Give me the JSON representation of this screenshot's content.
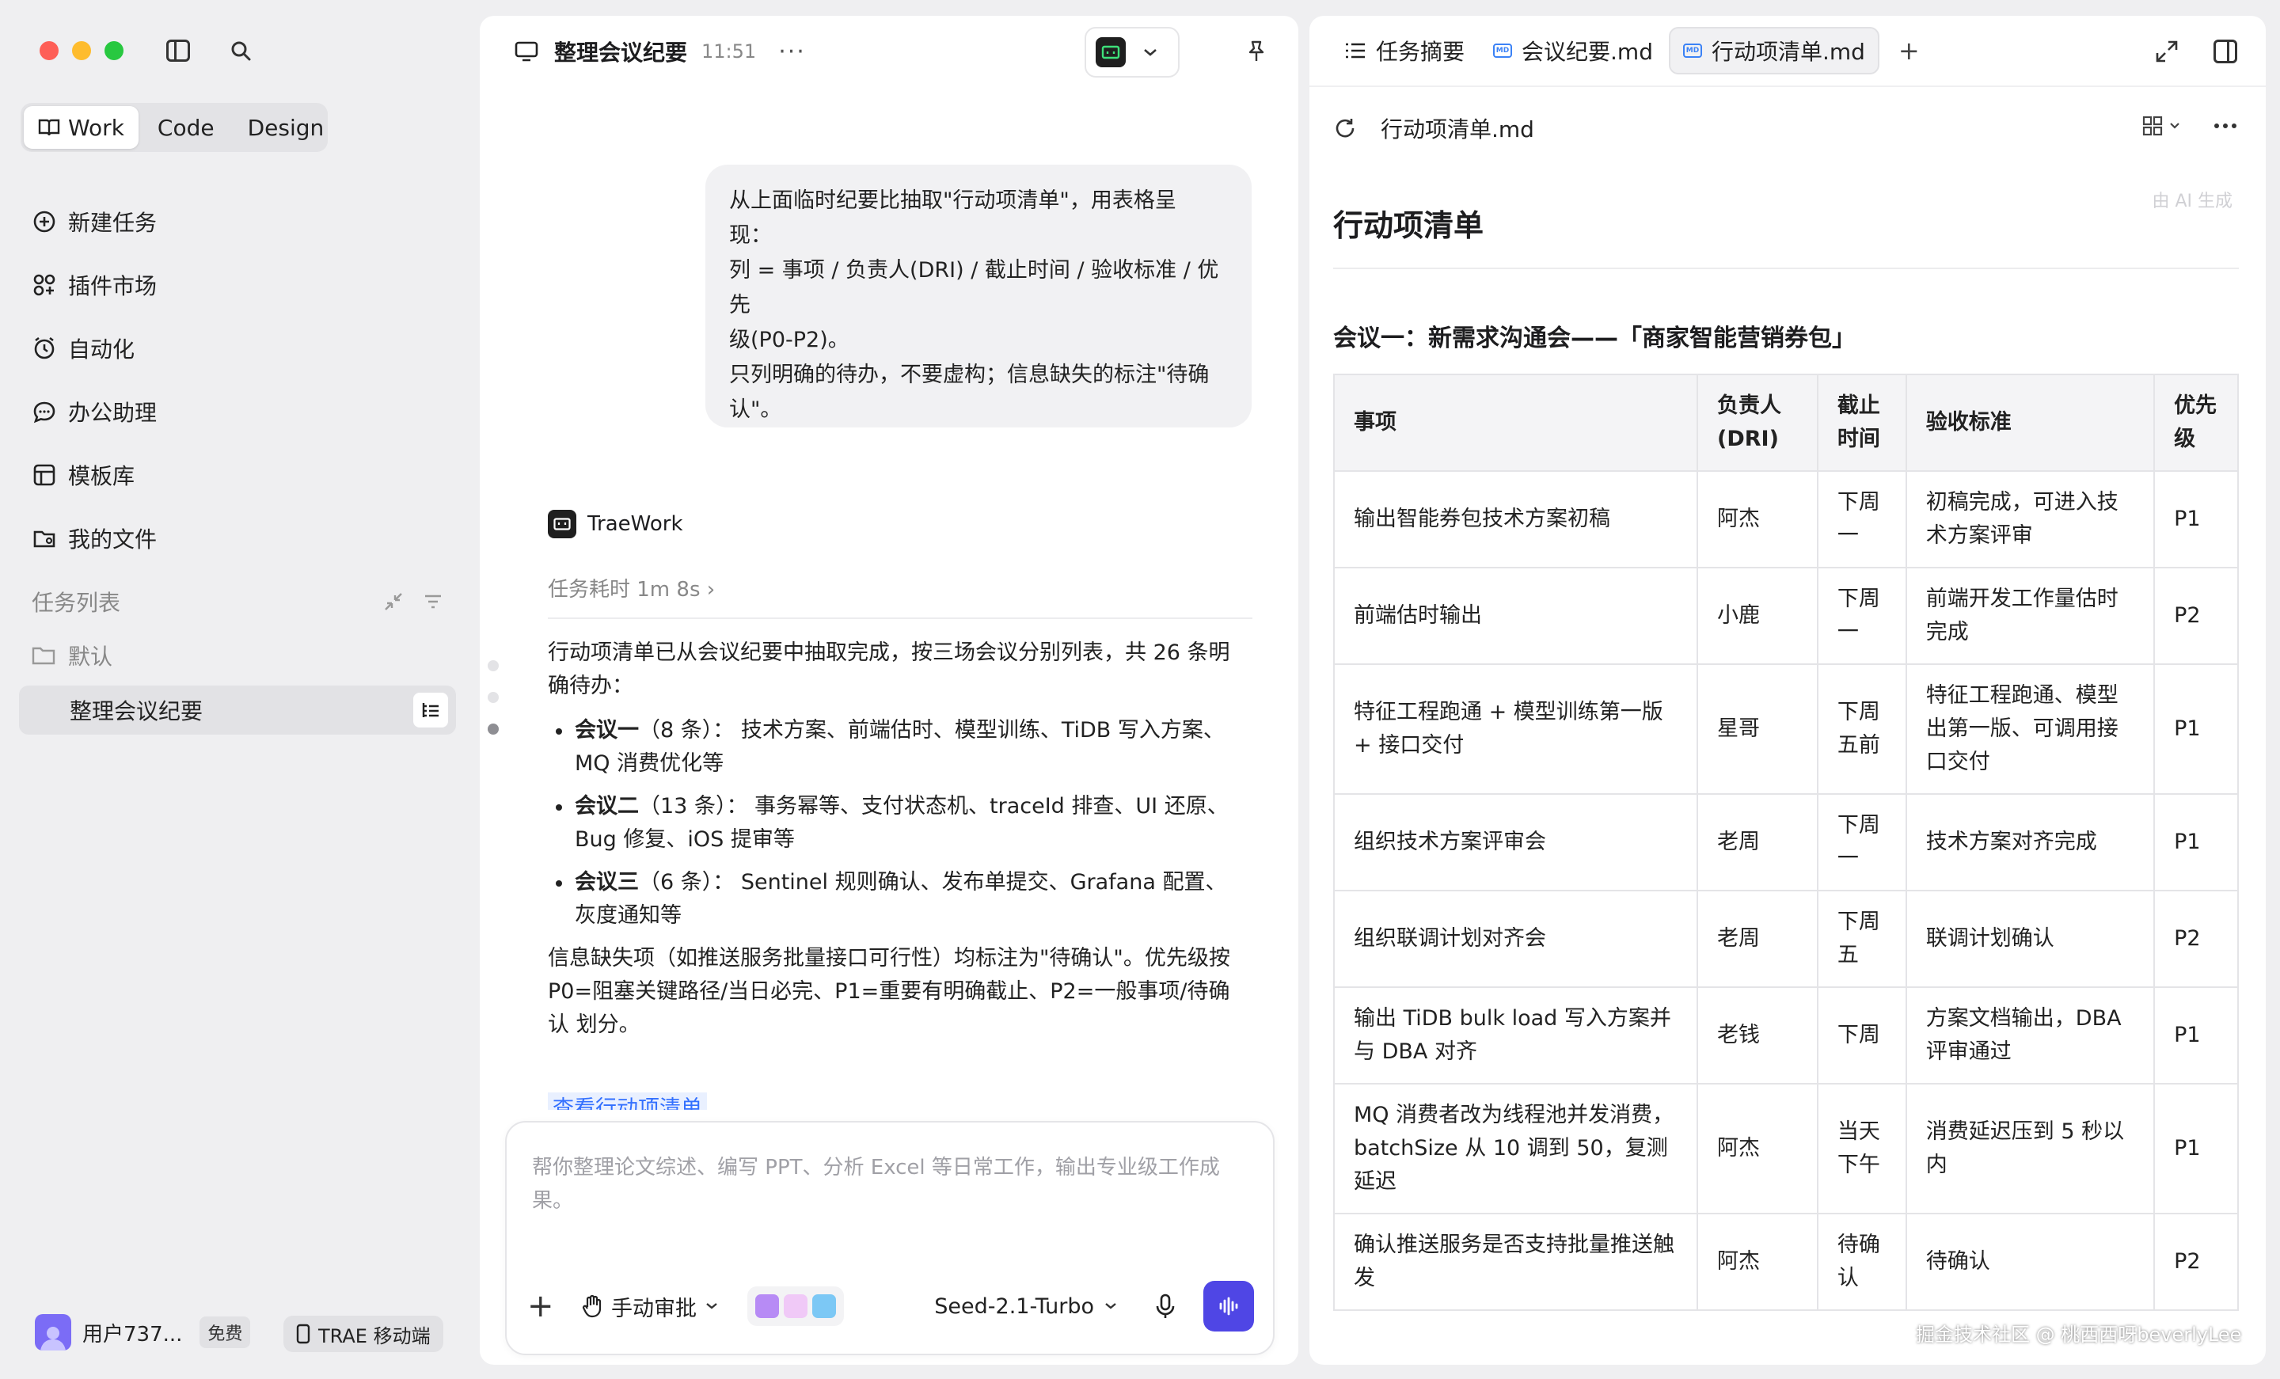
{
  "sidebar": {
    "mode_tabs": [
      "Work",
      "Code",
      "Design"
    ],
    "nav_items": [
      {
        "label": "新建任务",
        "icon": "plus-circle-icon"
      },
      {
        "label": "插件市场",
        "icon": "plugin-icon"
      },
      {
        "label": "自动化",
        "icon": "clock-icon"
      },
      {
        "label": "办公助理",
        "icon": "chat-icon"
      },
      {
        "label": "模板库",
        "icon": "template-icon"
      },
      {
        "label": "我的文件",
        "icon": "folder-user-icon"
      }
    ],
    "task_list_title": "任务列表",
    "folder_label": "默认",
    "active_task": "整理会议纪要",
    "user_name": "用户737...",
    "plan_badge": "免费",
    "mobile_button": "TRAE 移动端"
  },
  "chat": {
    "title": "整理会议纪要",
    "time": "11:51",
    "more": "···",
    "user_message": [
      "从上面临时纪要比抽取\"行动项清单\"，用表格呈",
      "现：",
      "列 = 事项 / 负责人(DRI) / 截止时间 / 验收标准 / 优先",
      "级(P0-P2)。",
      "只列明确的待办，不要虚构；信息缺失的标注\"待确",
      "认\"。"
    ],
    "bot_name": "TraeWork",
    "task_duration": "任务耗时 1m 8s ›",
    "answer_intro": "行动项清单已从会议纪要中抽取完成，按三场会议分别列表，共 26 条明确待办：",
    "bullets": [
      {
        "bold": "会议一",
        "text": "（8 条）： 技术方案、前端估时、模型训练、TiDB 写入方案、MQ 消费优化等"
      },
      {
        "bold": "会议二",
        "text": "（13 条）： 事务幂等、支付状态机、traceId 排查、UI 还原、Bug 修复、iOS 提审等"
      },
      {
        "bold": "会议三",
        "text": "（6 条）： Sentinel 规则确认、发布单提交、Grafana 配置、灰度通知等"
      }
    ],
    "answer_outro": "信息缺失项（如推送服务批量接口可行性）均标注为\"待确认\"。优先级按 P0=阻塞关键路径/当日必完、P1=重要有明确截止、P2=一般事项/待确认 划分。",
    "link_text": "查看行动项清单",
    "composer_placeholder": "帮你整理论文综述、编写 PPT、分析 Excel 等日常工作，输出专业级工作成果。",
    "approve_mode": "手动审批",
    "model": "Seed-2.1-Turbo"
  },
  "doc": {
    "tabs": [
      {
        "label": "任务摘要",
        "active": false
      },
      {
        "label": "会议纪要.md",
        "active": false
      },
      {
        "label": "行动项清单.md",
        "active": true
      }
    ],
    "filename": "行动项清单.md",
    "ai_tag": "由 AI 生成",
    "heading": "行动项清单",
    "section_title": "会议一：新需求沟通会——「商家智能营销券包」",
    "table_headers": [
      "事项",
      "负责人(DRI)",
      "截止时间",
      "验收标准",
      "优先级"
    ],
    "rows": [
      [
        "输出智能券包技术方案初稿",
        "阿杰",
        "下周一",
        "初稿完成，可进入技术方案评审",
        "P1"
      ],
      [
        "前端估时输出",
        "小鹿",
        "下周一",
        "前端开发工作量估时完成",
        "P2"
      ],
      [
        "特征工程跑通 + 模型训练第一版 + 接口交付",
        "星哥",
        "下周五前",
        "特征工程跑通、模型出第一版、可调用接口交付",
        "P1"
      ],
      [
        "组织技术方案评审会",
        "老周",
        "下周一",
        "技术方案对齐完成",
        "P1"
      ],
      [
        "组织联调计划对齐会",
        "老周",
        "下周五",
        "联调计划确认",
        "P2"
      ],
      [
        "输出 TiDB bulk load 写入方案并与 DBA 对齐",
        "老钱",
        "下周",
        "方案文档输出，DBA 评审通过",
        "P1"
      ],
      [
        "MQ 消费者改为线程池并发消费，batchSize 从 10 调到 50，复测延迟",
        "阿杰",
        "当天下午",
        "消费延迟压到 5 秒以内",
        "P1"
      ],
      [
        "确认推送服务是否支持批量推送触发",
        "阿杰",
        "待确认",
        "待确认",
        "P2"
      ]
    ]
  },
  "watermark": "掘金技术社区 @ 桃西西呀beverlyLee",
  "colors": {
    "accent": "#4f46e5",
    "link": "#3370ff"
  }
}
